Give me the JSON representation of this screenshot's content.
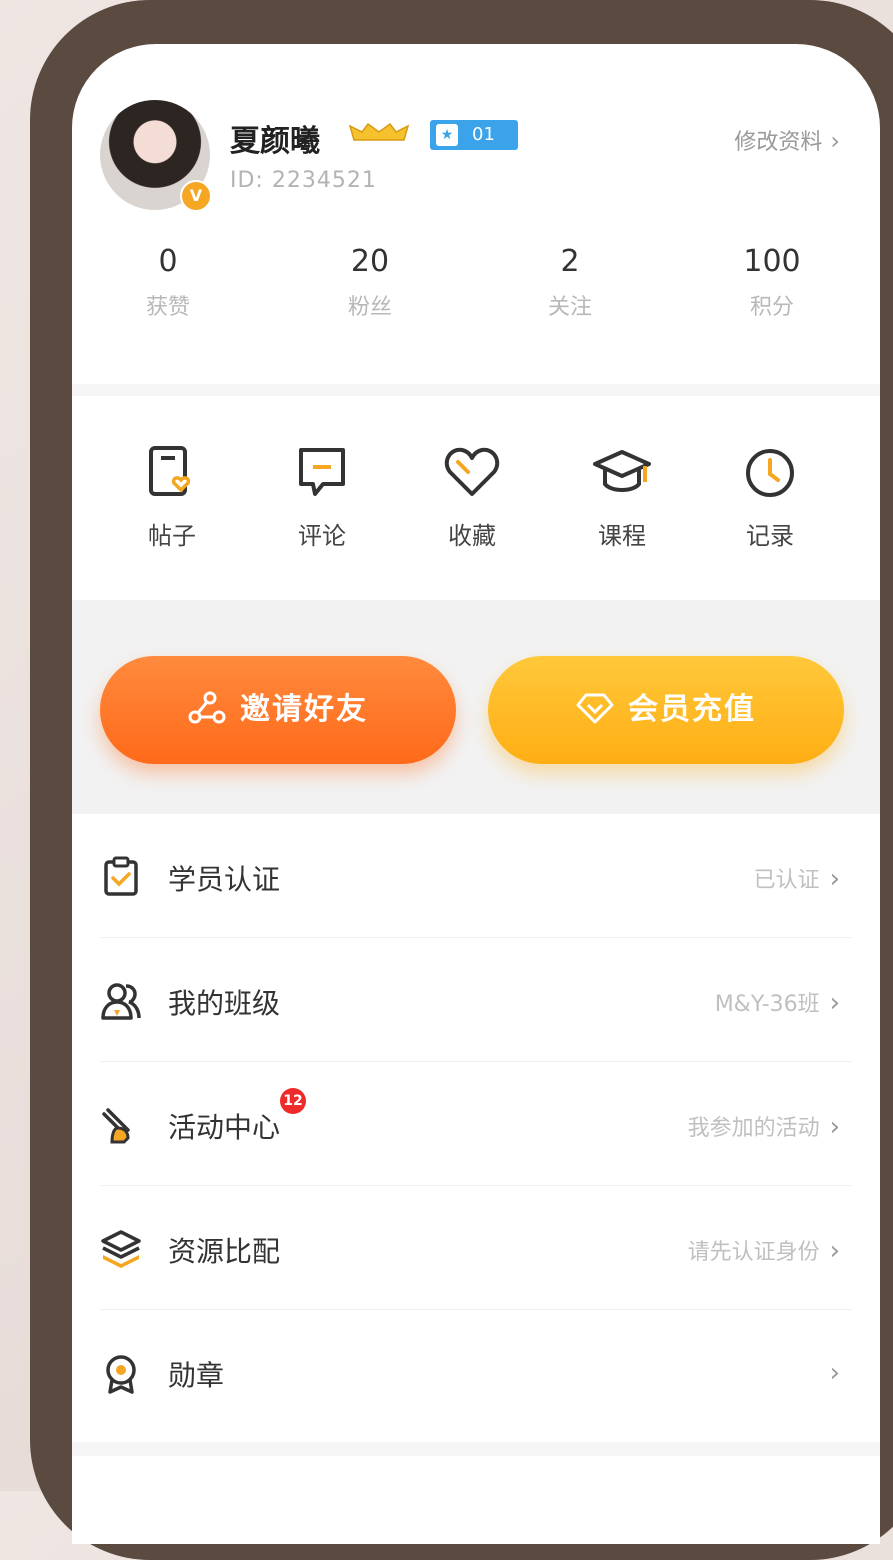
{
  "profile": {
    "username": "夏颜曦",
    "user_id": "ID: 2234521",
    "level": "01",
    "edit_label": "修改资料",
    "avatar_badge": "V"
  },
  "stats": [
    {
      "value": "0",
      "label": "获赞"
    },
    {
      "value": "20",
      "label": "粉丝"
    },
    {
      "value": "2",
      "label": "关注"
    },
    {
      "value": "100",
      "label": "积分"
    }
  ],
  "quick_actions": [
    {
      "label": "帖子",
      "icon": "post-icon"
    },
    {
      "label": "评论",
      "icon": "comment-icon"
    },
    {
      "label": "收藏",
      "icon": "heart-icon"
    },
    {
      "label": "课程",
      "icon": "graduation-cap-icon"
    },
    {
      "label": "记录",
      "icon": "clock-icon"
    }
  ],
  "buttons": {
    "invite_label": "邀请好友",
    "vip_label": "会员充值"
  },
  "menu": [
    {
      "label": "学员认证",
      "value": "已认证",
      "icon": "clipboard-check-icon"
    },
    {
      "label": "我的班级",
      "value": "M&Y-36班",
      "icon": "group-icon"
    },
    {
      "label": "活动中心",
      "value": "我参加的活动",
      "icon": "activity-icon",
      "badge": "12"
    },
    {
      "label": "资源比配",
      "value": "请先认证身份",
      "icon": "layers-icon"
    },
    {
      "label": "勋章",
      "value": "",
      "icon": "medal-icon"
    }
  ],
  "colors": {
    "accent_orange": "#ff6a1a",
    "accent_yellow": "#ffae14",
    "icon_yellow": "#f5a623",
    "level_blue": "#3aa3ea",
    "badge_red": "#ee2a2a"
  }
}
